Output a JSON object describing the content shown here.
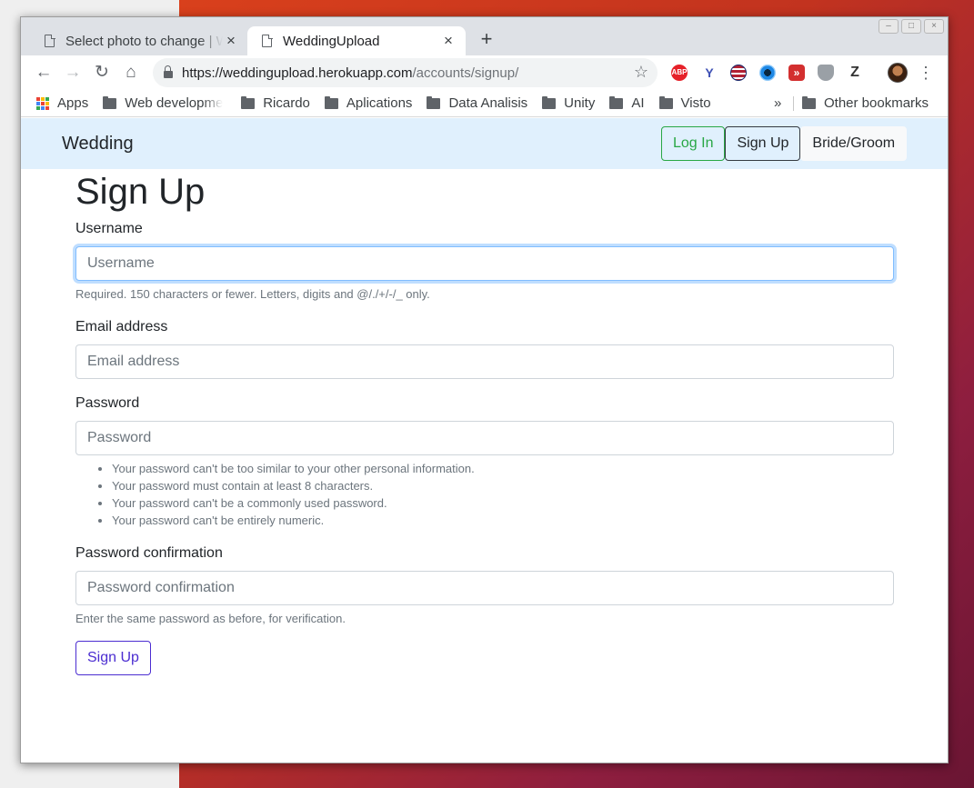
{
  "browser": {
    "tabs": [
      {
        "title": "Select photo to change | Wedding",
        "close": "×",
        "active": false
      },
      {
        "title": "WeddingUpload",
        "close": "×",
        "active": true
      }
    ],
    "new_tab": "+",
    "url_host": "https://weddingupload.herokuapp.com",
    "url_path": "/accounts/signup/",
    "nav_icons": {
      "back": "←",
      "forward": "→",
      "reload": "↻",
      "home": "⌂",
      "star": "☆",
      "menu": "⋮"
    },
    "extensions": [
      {
        "name": "adblock-icon",
        "label": "ABP",
        "color": "#e62129"
      },
      {
        "name": "y-extension-icon",
        "label": "Y",
        "color": "#3f51b5"
      },
      {
        "name": "flag-extension-icon",
        "label": "",
        "color": "#b22234"
      },
      {
        "name": "eye-extension-icon",
        "label": "",
        "color": "#1e88e5"
      },
      {
        "name": "fast-forward-extension-icon",
        "label": "»",
        "color": "#d32f2f"
      },
      {
        "name": "shield-extension-icon",
        "label": "",
        "color": "#9aa0a6"
      },
      {
        "name": "zotero-extension-icon",
        "label": "Z",
        "color": "#333333"
      }
    ]
  },
  "bookmarks": {
    "apps": "Apps",
    "items": [
      "Web developme",
      "Ricardo",
      "Aplications",
      "Data Analisis",
      "Unity",
      "AI",
      "Visto"
    ],
    "more": "»",
    "other": "Other bookmarks"
  },
  "navbar": {
    "brand": "Wedding",
    "login": "Log In",
    "signup": "Sign Up",
    "bride_groom": "Bride/Groom"
  },
  "form": {
    "title": "Sign Up",
    "username": {
      "label": "Username",
      "placeholder": "Username",
      "help": "Required. 150 characters or fewer. Letters, digits and @/./+/-/_ only."
    },
    "email": {
      "label": "Email address",
      "placeholder": "Email address"
    },
    "password": {
      "label": "Password",
      "placeholder": "Password",
      "help_items": [
        "Your password can't be too similar to your other personal information.",
        "Your password must contain at least 8 characters.",
        "Your password can't be a commonly used password.",
        "Your password can't be entirely numeric."
      ]
    },
    "password_confirm": {
      "label": "Password confirmation",
      "placeholder": "Password confirmation",
      "help": "Enter the same password as before, for verification."
    },
    "submit": "Sign Up"
  },
  "colors": {
    "navbar_bg": "#e0f0fd",
    "login_green": "#28a745",
    "submit_purple": "#4b2dd1",
    "focus_blue": "#80bdff"
  }
}
